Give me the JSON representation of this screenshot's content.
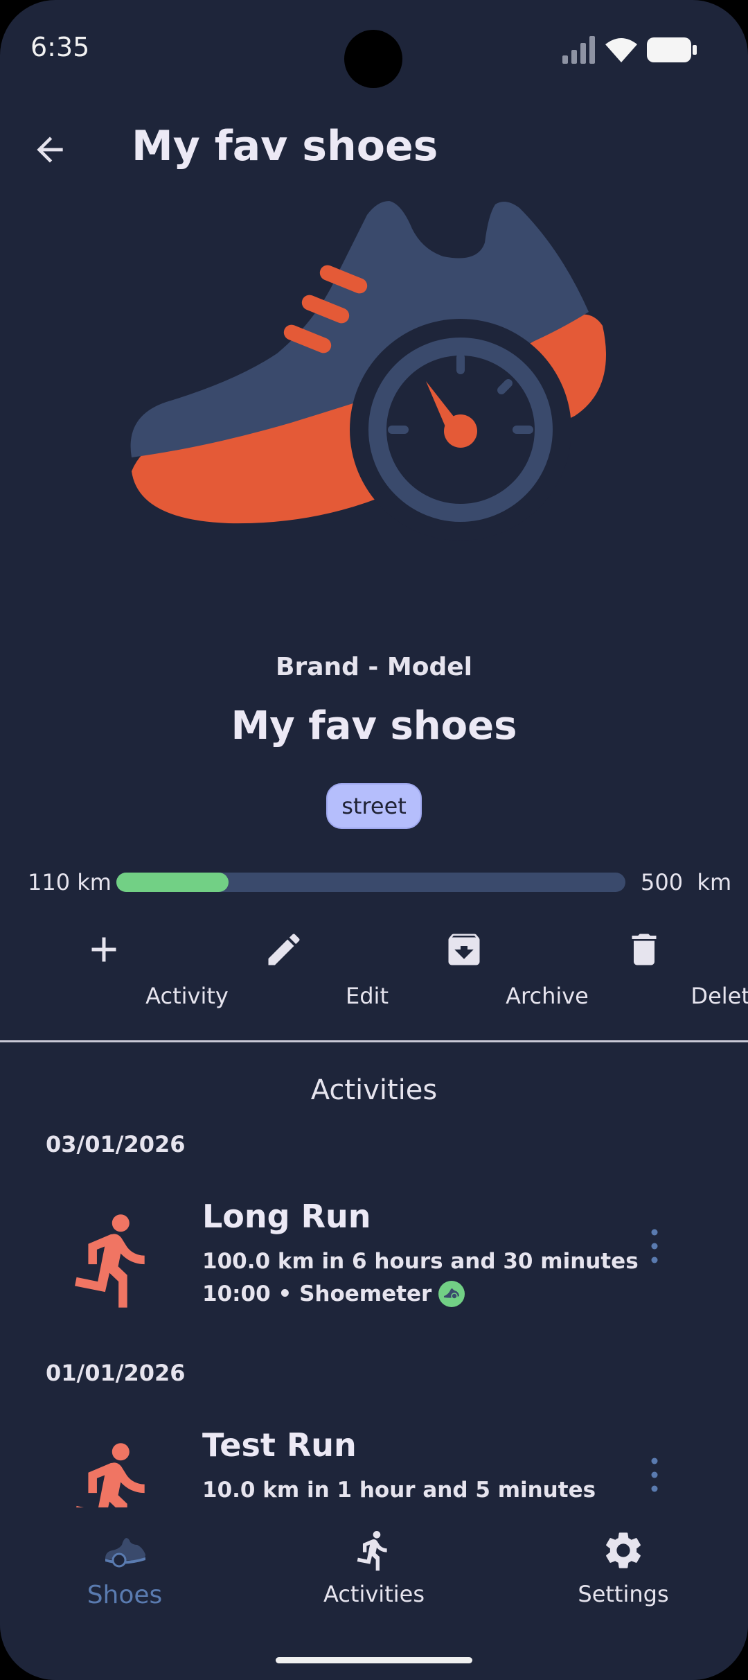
{
  "status_bar": {
    "time": "6:35"
  },
  "app_bar": {
    "title": "My fav shoes"
  },
  "shoe": {
    "brand_model": "Brand - Model",
    "name": "My fav shoes",
    "tag": "street",
    "distance_used": "110 km",
    "distance_limit": "500  km",
    "progress_fraction": 0.22
  },
  "actions": [
    {
      "label": "Activity",
      "icon": "add-icon"
    },
    {
      "label": "Edit",
      "icon": "pencil-icon"
    },
    {
      "label": "Archive",
      "icon": "archive-icon"
    },
    {
      "label": "Delete",
      "icon": "trash-icon"
    }
  ],
  "activities_section": {
    "title": "Activities",
    "groups": [
      {
        "date": "03/01/2026",
        "title": "Long Run",
        "summary": "100.0 km in 6 hours and 30 minutes",
        "meta": "10:00 • Shoemeter"
      },
      {
        "date": "01/01/2026",
        "title": "Test Run",
        "summary": "10.0 km in 1 hour and 5 minutes"
      }
    ]
  },
  "bottom_nav": [
    {
      "label": "Shoes",
      "icon": "shoe-icon",
      "active": true
    },
    {
      "label": "Activities",
      "icon": "runner-icon",
      "active": false
    },
    {
      "label": "Settings",
      "icon": "gear-icon",
      "active": false
    }
  ],
  "colors": {
    "background": "#1e253a",
    "accent_orange": "#e45a37",
    "runner_orange": "#f07563",
    "progress_fill": "#72d085",
    "progress_track": "#3a4a6c",
    "chip": "#b5befc",
    "nav_active": "#5a7bb0"
  }
}
